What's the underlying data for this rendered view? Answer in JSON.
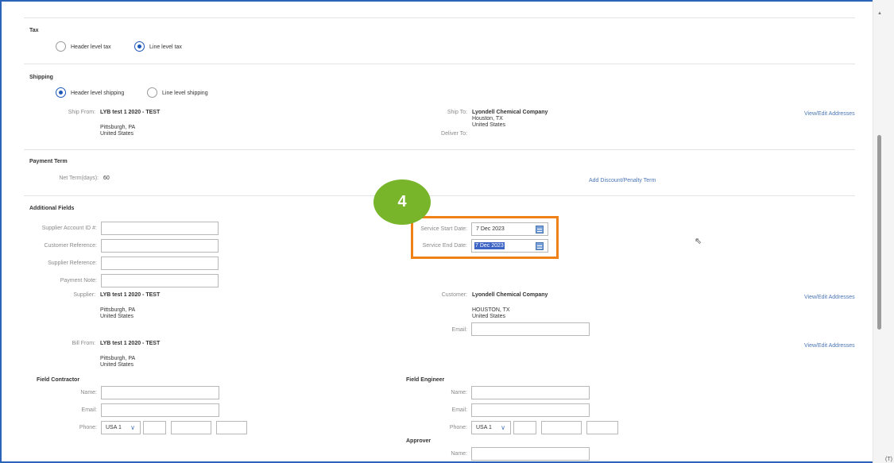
{
  "tax": {
    "title": "Tax",
    "options": [
      {
        "label": "Header level tax",
        "selected": false
      },
      {
        "label": "Line level tax",
        "selected": true
      }
    ]
  },
  "shipping": {
    "title": "Shipping",
    "options": [
      {
        "label": "Header level shipping",
        "selected": true
      },
      {
        "label": "Line level shipping",
        "selected": false
      }
    ],
    "ship_from_label": "Ship From:",
    "ship_from_name": "LYB test 1 2020 - TEST",
    "ship_from_city": "Pittsburgh, PA",
    "ship_from_country": "United States",
    "ship_to_label": "Ship To:",
    "ship_to_name": "Lyondell Chemical Company",
    "ship_to_city": "Houston, TX",
    "ship_to_country": "United States",
    "deliver_to_label": "Deliver To:",
    "view_edit_link": "View/Edit Addresses"
  },
  "payment": {
    "title": "Payment Term",
    "net_term_label": "Net Term(days):",
    "net_term_value": "60",
    "add_discount_link": "Add Discount/Penalty Term"
  },
  "step_badge": "4",
  "additional": {
    "title": "Additional Fields",
    "supplier_account_label": "Supplier Account ID #:",
    "customer_reference_label": "Customer Reference:",
    "supplier_reference_label": "Supplier Reference:",
    "payment_note_label": "Payment Note:",
    "service_start_label": "Service Start Date:",
    "service_start_value": "7 Dec 2023",
    "service_end_label": "Service End Date:",
    "service_end_value": "7 Dec 2023",
    "supplier_label": "Supplier:",
    "supplier_name": "LYB test 1 2020 - TEST",
    "supplier_city": "Pittsburgh, PA",
    "supplier_country": "United States",
    "customer_label": "Customer:",
    "customer_name": "Lyondell Chemical Company",
    "customer_city": "HOUSTON, TX",
    "customer_country": "United States",
    "email_label": "Email:",
    "bill_from_label": "Bill From:",
    "bill_from_name": "LYB test 1 2020 - TEST",
    "bill_from_city": "Pittsburgh, PA",
    "bill_from_country": "United States",
    "view_edit_link": "View/Edit Addresses"
  },
  "field_contractor": {
    "title": "Field Contractor",
    "name_label": "Name:",
    "email_label": "Email:",
    "phone_label": "Phone:",
    "phone_country": "USA 1"
  },
  "field_engineer": {
    "title": "Field Engineer",
    "name_label": "Name:",
    "email_label": "Email:",
    "phone_label": "Phone:",
    "phone_country": "USA 1"
  },
  "approver": {
    "title": "Approver",
    "name_label": "Name:"
  },
  "corner_text": "(T)"
}
